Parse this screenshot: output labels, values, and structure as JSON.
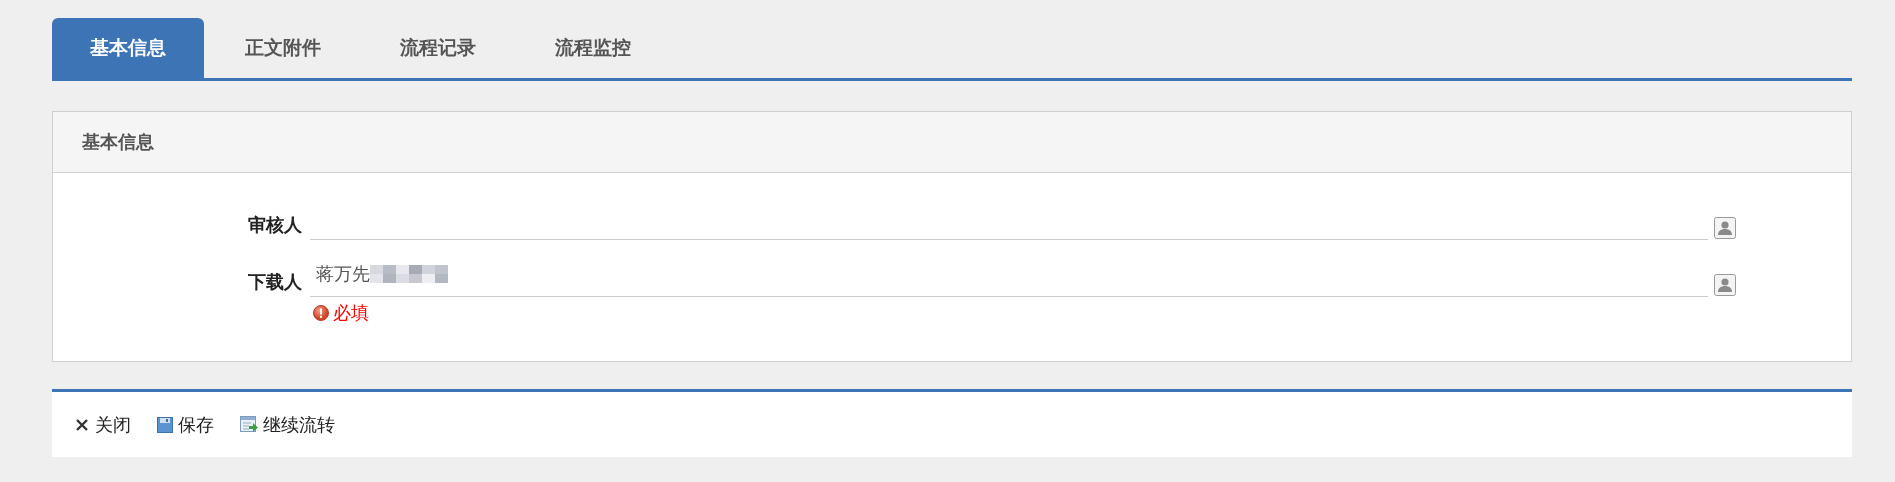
{
  "tabs": [
    {
      "label": "基本信息",
      "selected": true
    },
    {
      "label": "正文附件",
      "selected": false
    },
    {
      "label": "流程记录",
      "selected": false
    },
    {
      "label": "流程监控",
      "selected": false
    }
  ],
  "panel": {
    "title": "基本信息",
    "fields": [
      {
        "label": "审核人"
      },
      {
        "label": "下载人",
        "value": "蒋万先",
        "redacted": true,
        "error": "必填"
      }
    ]
  },
  "toolbar": [
    {
      "kind": "close",
      "label": "关闭"
    },
    {
      "kind": "save",
      "label": "保存"
    },
    {
      "kind": "forward",
      "label": "继续流转"
    }
  ]
}
